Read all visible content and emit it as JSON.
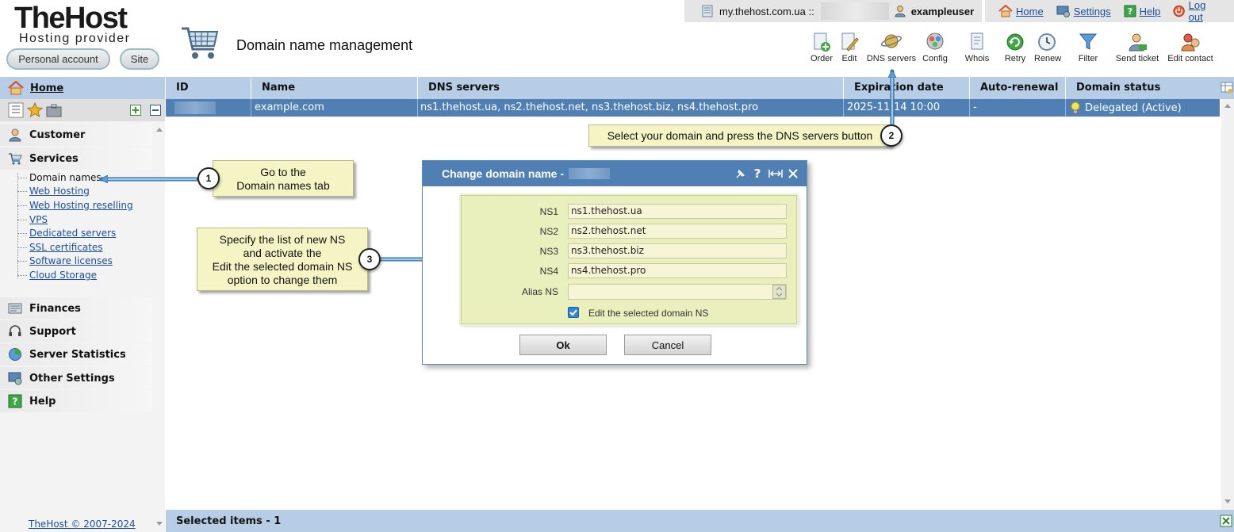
{
  "header": {
    "brand": "TheHost",
    "tagline": "Hosting provider",
    "personal_account_label": "Personal account",
    "site_label": "Site",
    "page_title": "Domain name management",
    "server_host": "my.thehost.com.ua ::",
    "username": "exampleuser",
    "links": {
      "home": "Home",
      "settings": "Settings",
      "help": "Help",
      "logout": "Log out"
    }
  },
  "toolbar": {
    "order": "Order",
    "edit": "Edit",
    "dns_servers": "DNS servers",
    "config": "Config",
    "whois": "Whois",
    "retry": "Retry",
    "renew": "Renew",
    "filter": "Filter",
    "send_ticket": "Send ticket",
    "edit_contact": "Edit contact"
  },
  "sidebar": {
    "home": "Home",
    "sections": {
      "customer": "Customer",
      "services": "Services",
      "finances": "Finances",
      "support": "Support",
      "server_statistics": "Server Statistics",
      "other_settings": "Other Settings",
      "help": "Help"
    },
    "services_items": [
      "Domain names",
      "Web Hosting",
      "Web Hosting reselling",
      "VPS",
      "Dedicated servers",
      "SSL certificates",
      "Software licenses",
      "Cloud Storage"
    ],
    "copyright": "TheHost © 2007-2024"
  },
  "grid": {
    "columns": [
      "ID",
      "Name",
      "DNS servers",
      "Expiration date",
      "Auto-renewal",
      "Domain status"
    ],
    "rows": [
      {
        "id": "",
        "name": "example.com",
        "dns": "ns1.thehost.ua, ns2.thehost.net, ns3.thehost.biz, ns4.thehost.pro",
        "expiration": "2025-11-14 10:00",
        "autorenew": "-",
        "status": "Delegated (Active)"
      }
    ],
    "selected_items": "Selected items - 1"
  },
  "callouts": {
    "step1": {
      "number": "1",
      "line1": "Go to the",
      "line2": "Domain names tab"
    },
    "step2": {
      "number": "2",
      "text": "Select your domain and press the DNS servers button"
    },
    "step3": {
      "number": "3",
      "line1": "Specify the list of new NS",
      "line2": "and activate the",
      "line3": "Edit the selected domain NS",
      "line4": "option to change them"
    }
  },
  "dialog": {
    "title": "Change domain name -",
    "fields": [
      {
        "label": "NS1",
        "value": "ns1.thehost.ua"
      },
      {
        "label": "NS2",
        "value": "ns2.thehost.net"
      },
      {
        "label": "NS3",
        "value": "ns3.thehost.biz"
      },
      {
        "label": "NS4",
        "value": "ns4.thehost.pro"
      }
    ],
    "alias_label": "Alias NS",
    "alias_value": "",
    "checkbox_label": "Edit the selected domain NS",
    "checkbox_checked": true,
    "ok_label": "Ok",
    "cancel_label": "Cancel"
  },
  "colors": {
    "header_blue": "#b7cde6",
    "selected_row": "#4f7fb3",
    "callout_yellow": "#f4f4c4",
    "arrow_blue": "#5aa0d6",
    "link_blue": "#1b4f9c"
  }
}
